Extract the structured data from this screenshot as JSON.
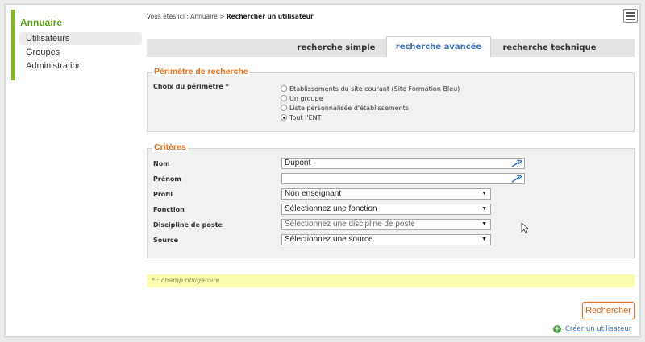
{
  "sidebar": {
    "title": "Annuaire",
    "items": [
      {
        "label": "Utilisateurs"
      },
      {
        "label": "Groupes"
      },
      {
        "label": "Administration"
      }
    ]
  },
  "breadcrumb": {
    "prefix": "Vous êtes ici : Annuaire > ",
    "current": "Rechercher un utilisateur"
  },
  "tabs": [
    {
      "label": "recherche simple"
    },
    {
      "label": "recherche avancée"
    },
    {
      "label": "recherche technique"
    }
  ],
  "perimetre": {
    "legend": "Périmètre de recherche",
    "label": "Choix du périmètre *",
    "options": [
      {
        "label": "Etablissements du site courant (Site Formation Bleu)"
      },
      {
        "label": "Un groupe"
      },
      {
        "label": "Liste personnalisée d'établissements"
      },
      {
        "label": "Tout l'ENT"
      }
    ],
    "selected": "Tout l'ENT"
  },
  "criteres": {
    "legend": "Critères",
    "nom_label": "Nom",
    "nom_value": "Dupont",
    "prenom_label": "Prénom",
    "prenom_value": "",
    "profil_label": "Profil",
    "profil_value": "Non enseignant",
    "fonction_label": "Fonction",
    "fonction_value": "Sélectionnez une fonction",
    "discipline_label": "Discipline de poste",
    "discipline_value": "Sélectionnez une discipline de poste",
    "source_label": "Source",
    "source_value": "Sélectionnez une source"
  },
  "note": "* : champ obligatoire",
  "actions": {
    "search_label": "Rechercher",
    "create_label": "Créer un utilisateur"
  },
  "colors": {
    "accent_green": "#7cbd1e",
    "legend_orange": "#e86d17",
    "link_blue": "#3b6fb6",
    "note_yellow": "#fbfbae"
  }
}
